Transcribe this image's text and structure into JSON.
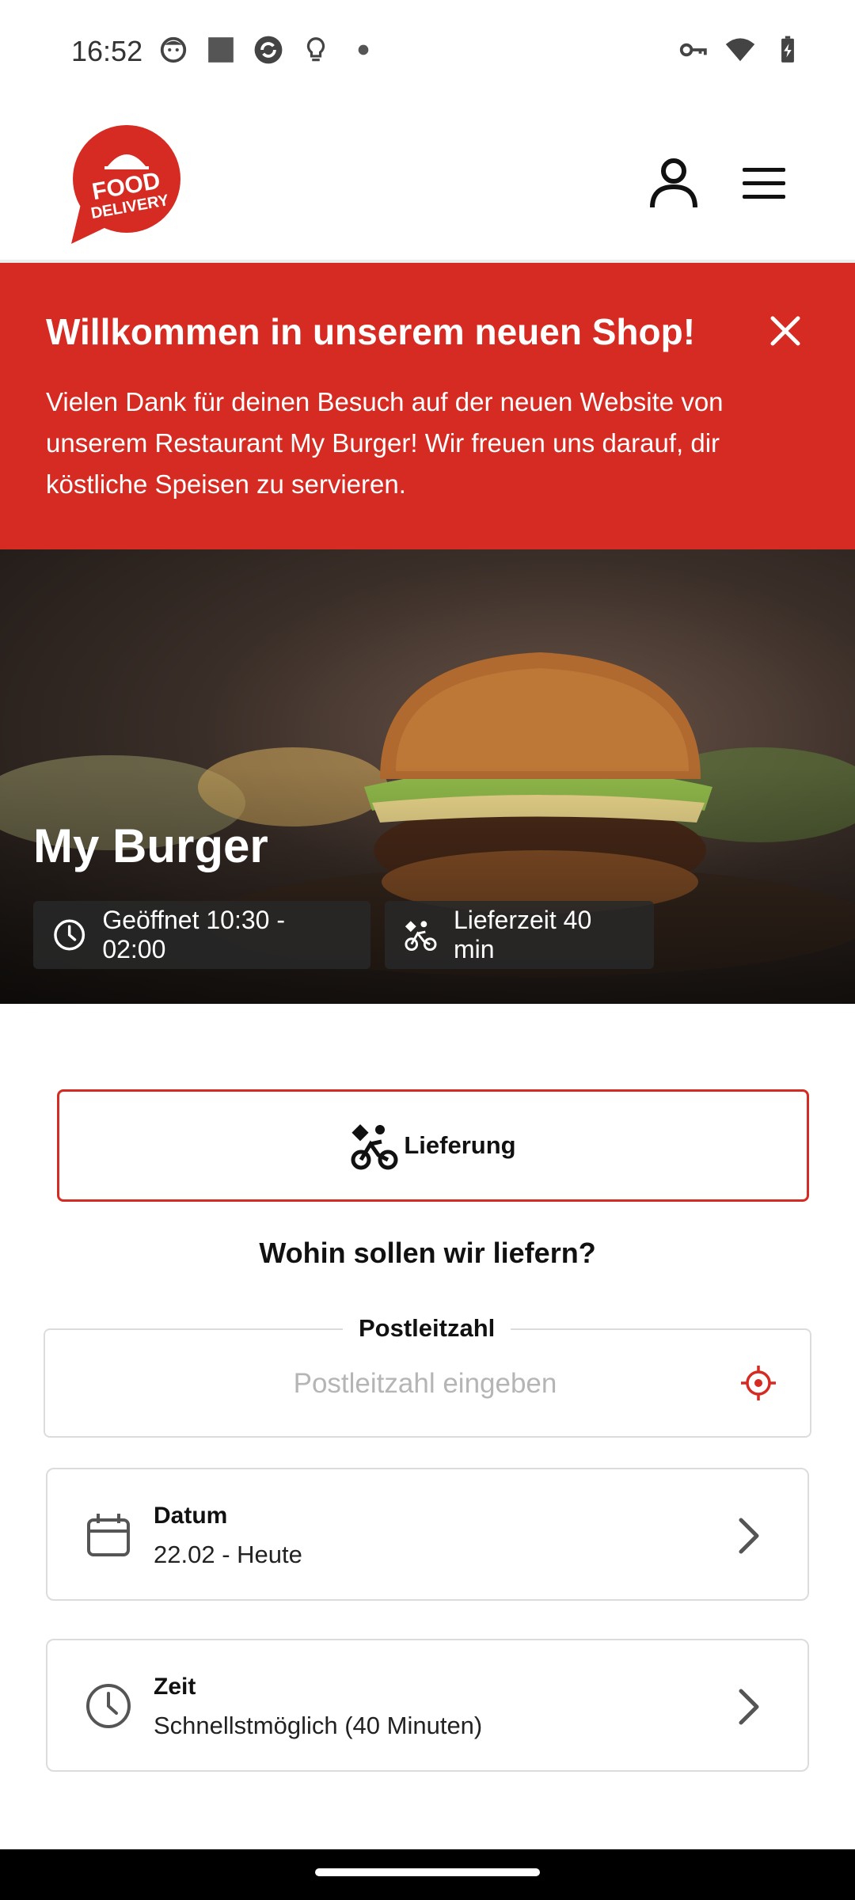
{
  "status_bar": {
    "time": "16:52",
    "left_icons": [
      "face-icon",
      "square-app-icon",
      "sync-app-icon",
      "lightbulb-icon",
      "dot-icon"
    ],
    "right_icons": [
      "vpn-key-icon",
      "wifi-icon",
      "battery-charging-icon"
    ]
  },
  "header": {
    "logo_line1": "FOOD",
    "logo_line2": "DELIVERY",
    "account_icon": "user-icon",
    "menu_icon": "hamburger-menu-icon"
  },
  "banner": {
    "title": "Willkommen in unserem neuen Shop!",
    "text": "Vielen Dank für deinen Besuch auf der neuen Website von unserem Restaurant My Burger! Wir freuen uns darauf, dir köstliche Speisen zu servieren.",
    "close_icon": "close-icon",
    "color": "#d52b22"
  },
  "hero": {
    "restaurant_name": "My Burger",
    "opening_hours": "Geöffnet 10:30 - 02:00",
    "delivery_time": "Lieferzeit 40 min"
  },
  "order": {
    "mode_label": "Lieferung",
    "question": "Wohin sollen wir liefern?",
    "zip_label": "Postleitzahl",
    "zip_placeholder": "Postleitzahl eingeben",
    "zip_value": "",
    "date_label": "Datum",
    "date_value": "22.02 - Heute",
    "time_label": "Zeit",
    "time_value": "Schnellstmöglich (40 Minuten)"
  },
  "colors": {
    "accent": "#d52b22",
    "border": "#dcdcdc",
    "placeholder": "#b5b5b5"
  }
}
